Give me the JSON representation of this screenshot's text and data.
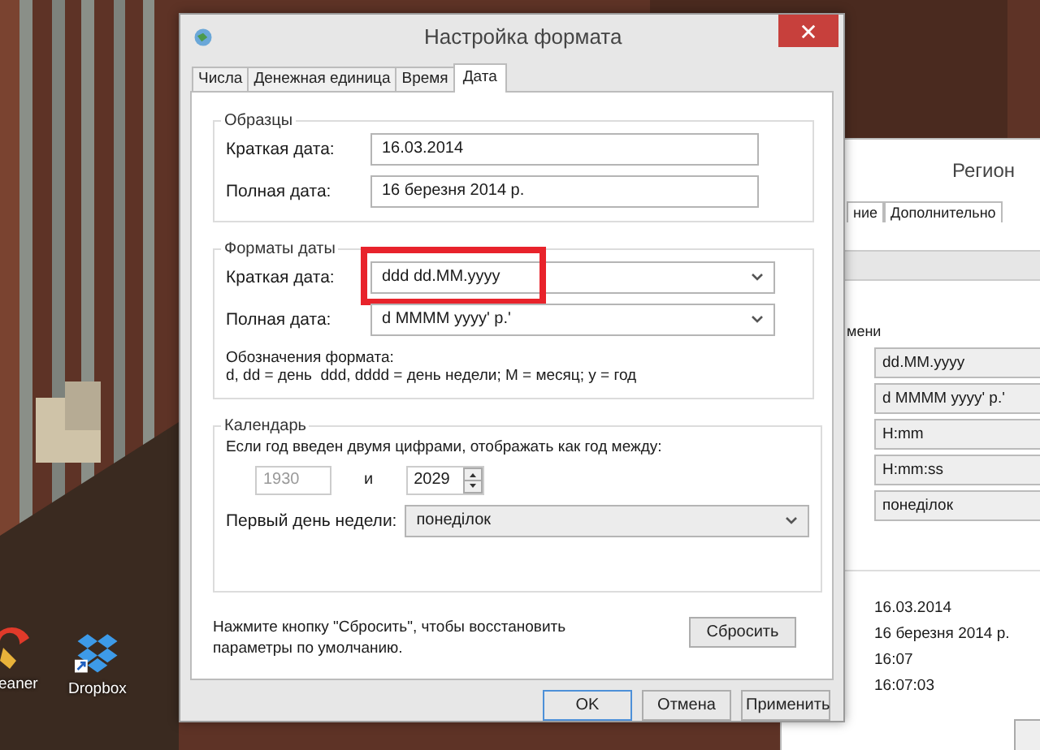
{
  "desktop": {
    "icons": [
      {
        "kind": "cleaner",
        "label": "eaner"
      },
      {
        "kind": "dropbox",
        "label": "Dropbox"
      }
    ]
  },
  "background_window": {
    "title": "Регион",
    "tabs": [
      "ние",
      "Дополнительно"
    ],
    "section_label": "мени",
    "formats": [
      "dd.MM.yyyy",
      "d MMMM yyyy' р.'",
      "H:mm",
      "H:mm:ss",
      "понеділок"
    ],
    "examples": [
      "16.03.2014",
      "16 березня 2014 р.",
      "16:07",
      "16:07:03"
    ]
  },
  "dialog": {
    "title": "Настройка формата",
    "tabs": [
      {
        "label": "Числа",
        "selected": false
      },
      {
        "label": "Денежная единица",
        "selected": false
      },
      {
        "label": "Время",
        "selected": false
      },
      {
        "label": "Дата",
        "selected": true
      }
    ],
    "samples": {
      "title": "Образцы",
      "rows": [
        {
          "label": "Краткая дата:",
          "value": "16.03.2014"
        },
        {
          "label": "Полная дата:",
          "value": "16 березня 2014 р."
        }
      ]
    },
    "date_formats": {
      "title": "Форматы даты",
      "rows": [
        {
          "label": "Краткая дата:",
          "value": "ddd dd.MM.yyyy",
          "highlighted": true
        },
        {
          "label": "Полная дата:",
          "value": "d MMMM yyyy' р.'",
          "highlighted": false
        }
      ],
      "legend_title": "Обозначения формата:",
      "legend": "d, dd = день  ddd, dddd = день недели; M = месяц; y = год"
    },
    "calendar": {
      "title": "Календарь",
      "two_digit_label": "Если год введен двумя цифрами, отображать как год между:",
      "year_from": {
        "value": "1930",
        "disabled": true
      },
      "and": "и",
      "year_to": {
        "value": "2029",
        "disabled": false
      },
      "first_day_label": "Первый день недели:",
      "first_day": "понеділок"
    },
    "reset_note": "Нажмите кнопку \"Сбросить\", чтобы восстановить параметры по умолчанию.",
    "reset_button": "Сбросить",
    "buttons": [
      {
        "label": "OK",
        "default": true
      },
      {
        "label": "Отмена",
        "default": false
      },
      {
        "label": "Применить",
        "default": false
      }
    ]
  }
}
